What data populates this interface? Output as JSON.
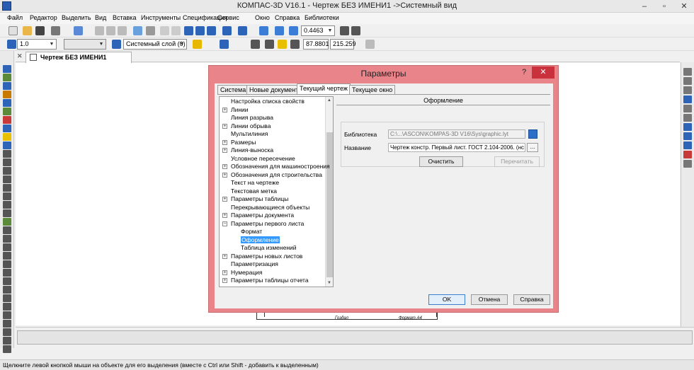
{
  "window": {
    "title": "КОМПАС-3D V16.1 - Чертеж БЕЗ ИМЕНИ1 ->Системный вид"
  },
  "menu": [
    "Файл",
    "Редактор",
    "Выделить",
    "Вид",
    "Вставка",
    "Инструменты",
    "Спецификация",
    "Сервис",
    "Окно",
    "Справка",
    "Библиотеки"
  ],
  "toolbar1": {
    "zoom_value": "0.4463"
  },
  "toolbar2": {
    "scale_value": "1.0",
    "layer_value": "Системный слой (0)",
    "coord_x": "87.8801",
    "coord_y": "215.259"
  },
  "document_tab": {
    "label": "Чертеж БЕЗ ИМЕНИ1"
  },
  "status_bar": "Щелкните левой кнопкой мыши на объекте для его выделения (вместе с Ctrl или Shift - добавить к выделенным)",
  "drawing_frame": {
    "labels": [
      "Гоздал",
      "Формат А4"
    ]
  },
  "dialog": {
    "title": "Параметры",
    "help": "?",
    "close": "✕",
    "tabs": [
      "Система",
      "Новые документы",
      "Текущий чертеж",
      "Текущее окно"
    ],
    "active_tab": "Текущий чертеж",
    "tree": [
      {
        "label": "Настройка списка свойств",
        "expandable": false,
        "level": 0
      },
      {
        "label": "Линии",
        "expandable": true,
        "level": 0
      },
      {
        "label": "Линия разрыва",
        "expandable": false,
        "level": 0
      },
      {
        "label": "Линии обрыва",
        "expandable": true,
        "level": 0
      },
      {
        "label": "Мультилиния",
        "expandable": false,
        "level": 0
      },
      {
        "label": "Размеры",
        "expandable": true,
        "level": 0
      },
      {
        "label": "Линия-выноска",
        "expandable": true,
        "level": 0
      },
      {
        "label": "Условное пересечение",
        "expandable": false,
        "level": 0
      },
      {
        "label": "Обозначения для машиностроения",
        "expandable": true,
        "level": 0
      },
      {
        "label": "Обозначения для строительства",
        "expandable": true,
        "level": 0
      },
      {
        "label": "Текст на чертеже",
        "expandable": false,
        "level": 0
      },
      {
        "label": "Текстовая метка",
        "expandable": false,
        "level": 0
      },
      {
        "label": "Параметры таблицы",
        "expandable": true,
        "level": 0
      },
      {
        "label": "Перекрывающиеся объекты",
        "expandable": false,
        "level": 0
      },
      {
        "label": "Параметры документа",
        "expandable": true,
        "level": 0
      },
      {
        "label": "Параметры первого листа",
        "expandable": true,
        "expanded": true,
        "level": 0
      },
      {
        "label": "Формат",
        "expandable": false,
        "level": 1
      },
      {
        "label": "Оформление",
        "expandable": false,
        "level": 1,
        "selected": true
      },
      {
        "label": "Таблица изменений",
        "expandable": false,
        "level": 1
      },
      {
        "label": "Параметры новых листов",
        "expandable": true,
        "level": 0
      },
      {
        "label": "Параметризация",
        "expandable": false,
        "level": 0
      },
      {
        "label": "Нумерация",
        "expandable": true,
        "level": 0
      },
      {
        "label": "Параметры таблицы отчета",
        "expandable": true,
        "level": 0
      }
    ],
    "panel": {
      "header": "Оформление",
      "library_label": "Библиотека",
      "library_value": "C:\\...\\ASCON\\KOMPAS-3D V16\\Sys\\graphic.lyt",
      "name_label": "Название",
      "name_value": "Чертеж констр. Первый лист. ГОСТ 2.104-2006. (нс",
      "browse": "...",
      "clear_button": "Очистить",
      "reread_button": "Перечитать"
    },
    "ok_button": "OK",
    "cancel_button": "Отмена",
    "help_button": "Справка"
  },
  "colors": {
    "dialog_frame": "#e8848a",
    "close_button": "#c9323c",
    "selection": "#3399ff"
  }
}
